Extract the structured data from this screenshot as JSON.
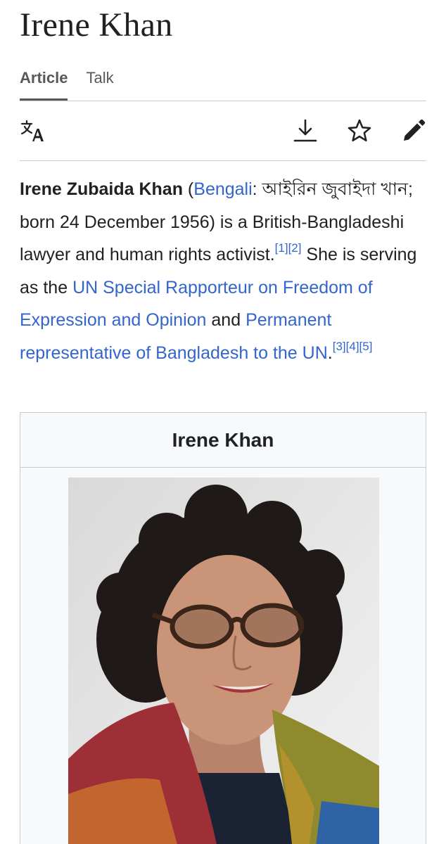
{
  "header": {
    "title": "Irene Khan"
  },
  "tabs": [
    {
      "label": "Article",
      "active": true
    },
    {
      "label": "Talk",
      "active": false
    }
  ],
  "toolbar": {
    "icons": [
      "translate-icon",
      "download-icon",
      "star-icon",
      "edit-pencil-icon"
    ]
  },
  "lead": {
    "name": "Irene Zubaida Khan",
    "open_paren": " (",
    "lang_link": "Bengali",
    "bengali_text": ": আইরিন জুবাইদা খান; born 24 December 1956) is a British-Bangladeshi lawyer and human rights activist.",
    "ref1": "[1]",
    "ref2": "[2]",
    "serving_text": " She is serving as the ",
    "link1": "UN Special Rapporteur on Freedom of Expression and Opinion",
    "and_text": " and ",
    "link2": "Permanent representative of Bangladesh to the UN",
    "end_text": ".",
    "ref3": "[3]",
    "ref4": "[4]",
    "ref5": "[5]"
  },
  "infobox": {
    "title": "Irene Khan"
  },
  "colors": {
    "link": "#3366cc",
    "text": "#202122",
    "border": "#c8ccd1",
    "muted": "#54595d"
  }
}
